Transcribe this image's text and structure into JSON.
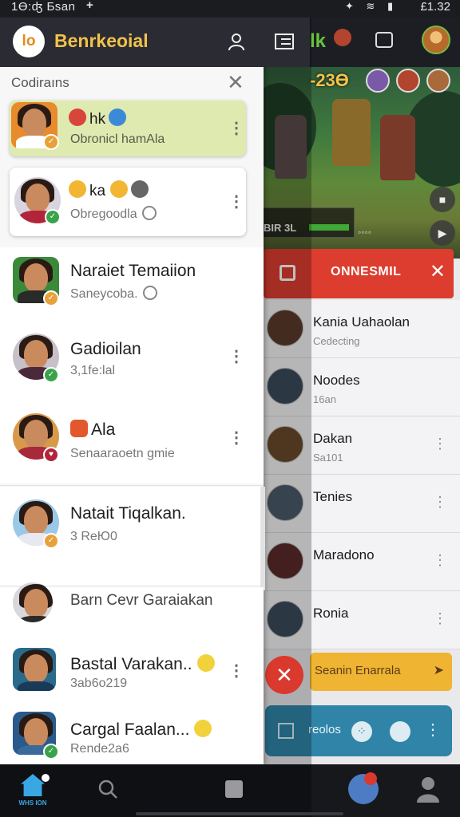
{
  "status_bar": {
    "left_text": "1Ɵ:ʤ Ƃsan",
    "time": "£1.32"
  },
  "header": {
    "logo_text": "lo",
    "title": "Bеnrkeoial"
  },
  "panel": {
    "title": "Codiraıns"
  },
  "chats": [
    {
      "name": "hk",
      "sub": "Obronicl hamAla"
    },
    {
      "name": "ka",
      "sub": "Obregoodla"
    },
    {
      "name": "Naraiet Temaiion",
      "sub": "Saneycoba."
    },
    {
      "name": "Gadioilan",
      "sub": "3,1fe:lal"
    },
    {
      "name": "Ala",
      "sub": "Senaaraoetn gmie"
    },
    {
      "name": "Natait Tiqalkan.",
      "sub": "3 ReЮ0"
    },
    {
      "name": "Barn Cevr Garaiakan",
      "sub": ""
    },
    {
      "name": "Bastal Varakan..",
      "sub": "3ab6o219"
    },
    {
      "name": "Cargal Faalan...",
      "sub": "Rende2a6"
    }
  ],
  "game": {
    "score": "-23Ɵ",
    "hud_text": "BIR 3L"
  },
  "background": {
    "banner_label": "ONNESMIL",
    "list": [
      {
        "name": "Kania Uahaolan",
        "sub": "Cedecting"
      },
      {
        "name": "Noodes",
        "sub": "16an"
      },
      {
        "name": "Dakan",
        "sub": "Sa101"
      },
      {
        "name": "Tenies",
        "sub": ""
      },
      {
        "name": "Maradono",
        "sub": ""
      },
      {
        "name": "Ronia",
        "sub": ""
      }
    ],
    "orange_label": "Seanin Enarrala",
    "teal_label": "reolos",
    "top_logo": "lk"
  },
  "nav": {
    "home_label": "WHS ION"
  },
  "colors": {
    "accent": "#39a7e3",
    "title": "#f2c24b",
    "active_card": "#dfeab1",
    "red": "#dc3d2f",
    "orange": "#efb431",
    "teal": "#2f84a8"
  }
}
